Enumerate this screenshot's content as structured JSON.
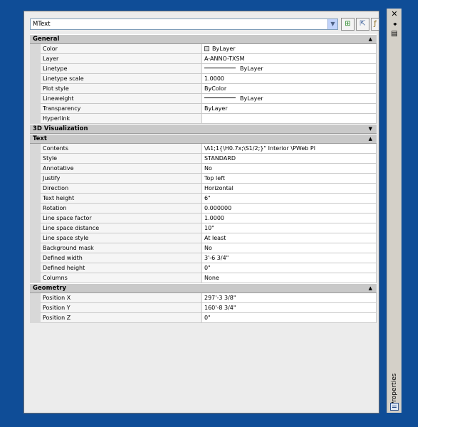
{
  "toolbar": {
    "object_type": "MText",
    "quick_select_icon": "quick-select-icon",
    "select_objects_icon": "select-objects-icon",
    "toggle_pickadd_icon": "toggle-pickadd-icon"
  },
  "titlebar": {
    "title": "Properties",
    "close_glyph": "✕",
    "autohide_glyph": "◂▸",
    "menu_glyph": "▤"
  },
  "sections": {
    "general": {
      "title": "General",
      "rows": [
        {
          "name": "Color",
          "value": "ByLayer"
        },
        {
          "name": "Layer",
          "value": "A-ANNO-TXSM"
        },
        {
          "name": "Linetype",
          "value": "ByLayer"
        },
        {
          "name": "Linetype scale",
          "value": "1.0000"
        },
        {
          "name": "Plot style",
          "value": "ByColor"
        },
        {
          "name": "Lineweight",
          "value": "ByLayer"
        },
        {
          "name": "Transparency",
          "value": "ByLayer"
        },
        {
          "name": "Hyperlink",
          "value": ""
        }
      ]
    },
    "visualization": {
      "title": "3D Visualization"
    },
    "text": {
      "title": "Text",
      "rows": [
        {
          "name": "Contents",
          "value": "\\A1;1{\\H0.7x;\\S1/2;}\" Interior \\PWeb Pl"
        },
        {
          "name": "Style",
          "value": "STANDARD"
        },
        {
          "name": "Annotative",
          "value": "No"
        },
        {
          "name": "Justify",
          "value": "Top left"
        },
        {
          "name": "Direction",
          "value": "Horizontal"
        },
        {
          "name": "Text height",
          "value": "6\""
        },
        {
          "name": "Rotation",
          "value": "0.000000"
        },
        {
          "name": "Line space factor",
          "value": "1.0000"
        },
        {
          "name": "Line space distance",
          "value": "10\""
        },
        {
          "name": "Line space style",
          "value": "At least"
        },
        {
          "name": "Background mask",
          "value": "No"
        },
        {
          "name": "Defined width",
          "value": "3'-6 3/4\""
        },
        {
          "name": "Defined height",
          "value": "0\""
        },
        {
          "name": "Columns",
          "value": "None"
        }
      ]
    },
    "geometry": {
      "title": "Geometry",
      "rows": [
        {
          "name": "Position X",
          "value": "297'-3 3/8\""
        },
        {
          "name": "Position Y",
          "value": "160'-8 3/4\""
        },
        {
          "name": "Position Z",
          "value": "0\""
        }
      ]
    }
  },
  "colors": {
    "background": "#0f4d97",
    "section_header": "#c9c9c9",
    "palette": "#ececec"
  }
}
